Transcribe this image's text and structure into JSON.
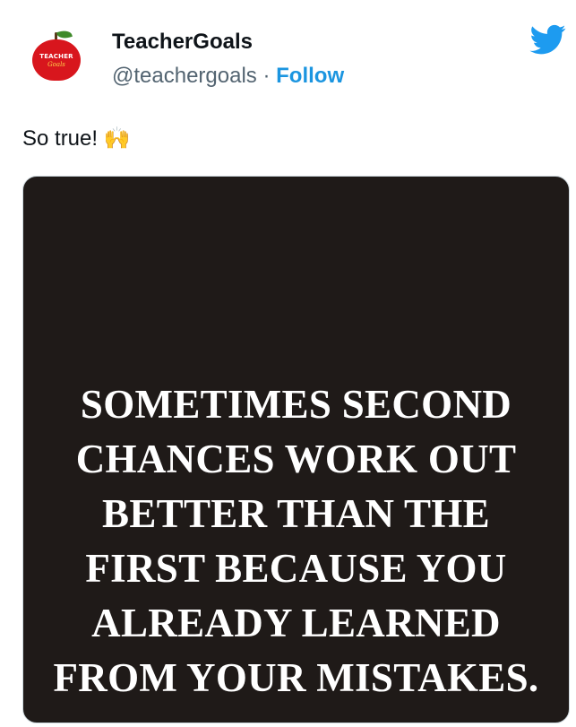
{
  "account": {
    "display_name": "TeacherGoals",
    "handle": "@teachergoals",
    "separator": "·",
    "follow_label": "Follow",
    "avatar": {
      "line1": "TEACHER",
      "line2": "Goals",
      "icon": "apple-icon"
    }
  },
  "brand_icon": "twitter-bird-icon",
  "colors": {
    "twitter_blue": "#1d9bf0",
    "follow_blue": "#1b95e0",
    "apple_red": "#d8161d",
    "media_bg": "#1f1a18"
  },
  "tweet": {
    "text": "So true! 🙌"
  },
  "media": {
    "quote_lines": [
      "SOMETIMES SECOND",
      "CHANCES WORK OUT",
      "BETTER THAN THE",
      "FIRST BECAUSE YOU",
      "ALREADY LEARNED",
      "FROM YOUR MISTAKES."
    ]
  }
}
